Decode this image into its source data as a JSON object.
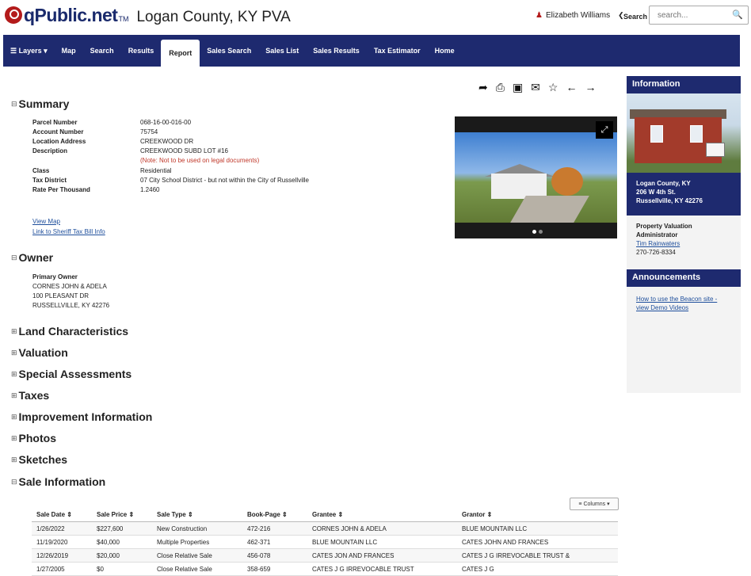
{
  "header": {
    "logo_text": "qPublic.net",
    "logo_tm": "TM",
    "county_title": "Logan County, KY PVA",
    "user_name": "Elizabeth Williams",
    "search_label": "Search",
    "search_placeholder": "search..."
  },
  "nav": {
    "items": [
      "Layers",
      "Map",
      "Search",
      "Results",
      "Report",
      "Sales Search",
      "Sales List",
      "Sales Results",
      "Tax Estimator",
      "Home"
    ],
    "active": "Report"
  },
  "summary": {
    "title": "Summary",
    "fields": [
      {
        "label": "Parcel Number",
        "value": "068-16-00-016-00"
      },
      {
        "label": "Account Number",
        "value": "75754"
      },
      {
        "label": "Location Address",
        "value": "CREEKWOOD DR"
      },
      {
        "label": "Description",
        "value": "CREEKWOOD SUBD LOT #16"
      },
      {
        "label": "",
        "value": "(Note: Not to be used on legal documents)"
      },
      {
        "label": "Class",
        "value": "Residential"
      },
      {
        "label": "Tax District",
        "value": "07 City School District - but not within the City of Russellville"
      },
      {
        "label": "Rate Per Thousand",
        "value": "1.2460"
      }
    ],
    "links": [
      "View Map",
      "Link to Sheriff Tax Bill Info"
    ]
  },
  "owner": {
    "title": "Owner",
    "label": "Primary Owner",
    "lines": [
      "CORNES JOHN & ADELA",
      "100 PLEASANT DR",
      "RUSSELLVILLE, KY 42276"
    ]
  },
  "sections": [
    "Land Characteristics",
    "Valuation",
    "Special Assessments",
    "Taxes",
    "Improvement Information",
    "Photos",
    "Sketches",
    "Sale Information"
  ],
  "sidebar": {
    "info_title": "Information",
    "office_lines": [
      "Logan County, KY",
      "206 W 4th St.",
      "Russellville, KY 42276"
    ],
    "admin_title": "Property Valuation Administrator",
    "admin_name": "Tim Rainwaters",
    "admin_phone": "270-726-8334",
    "announcements_title": "Announcements",
    "announcement_link": "How to use the Beacon site - view Demo Videos"
  },
  "sales": {
    "columns_button": "Columns",
    "headers": [
      "Sale Date",
      "Sale Price",
      "Sale Type",
      "Book-Page",
      "Grantee",
      "Grantor"
    ],
    "rows": [
      [
        "1/26/2022",
        "$227,600",
        "New Construction",
        "472-216",
        "CORNES JOHN & ADELA",
        "BLUE MOUNTAIN LLC"
      ],
      [
        "11/19/2020",
        "$40,000",
        "Multiple Properties",
        "462-371",
        "BLUE MOUNTAIN LLC",
        "CATES JOHN AND FRANCES"
      ],
      [
        "12/26/2019",
        "$20,000",
        "Close Relative Sale",
        "456-078",
        "CATES JON AND FRANCES",
        "CATES J G IRREVOCABLE TRUST &"
      ],
      [
        "1/27/2005",
        "$0",
        "Close Relative Sale",
        "358-659",
        "CATES J G IRREVOCABLE TRUST",
        "CATES J G"
      ]
    ]
  }
}
